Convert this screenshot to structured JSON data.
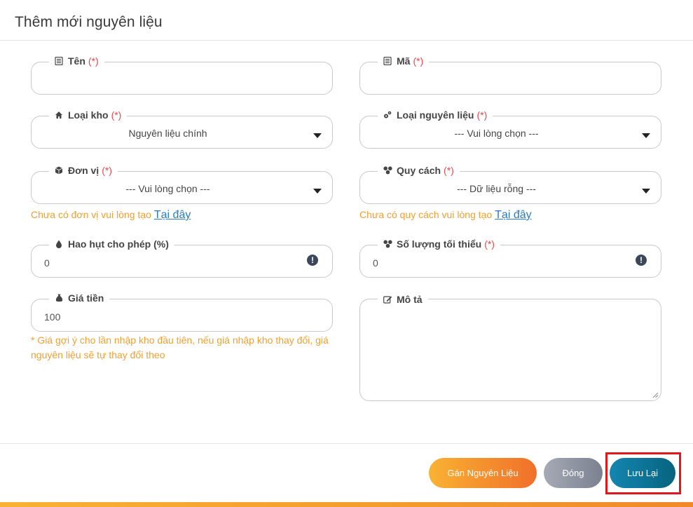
{
  "header": {
    "title": "Thêm mới nguyên liệu"
  },
  "required_mark": "(*)",
  "fields": {
    "ten": {
      "label": "Tên",
      "icon": "list-icon",
      "value": ""
    },
    "ma": {
      "label": "Mã",
      "icon": "list-icon",
      "value": ""
    },
    "loai_kho": {
      "label": "Loại kho",
      "icon": "home-icon",
      "value": "Nguyên liệu chính"
    },
    "loai_nguyen_lieu": {
      "label": "Loại nguyên liệu",
      "icon": "gears-icon",
      "value": "--- Vui lòng chọn ---"
    },
    "don_vi": {
      "label": "Đơn vị",
      "icon": "cube-icon",
      "value": "--- Vui lòng chọn ---"
    },
    "quy_cach": {
      "label": "Quy cách",
      "icon": "cubes-icon",
      "value": "--- Dữ liệu rỗng ---"
    },
    "hao_hut": {
      "label": "Hao hụt cho phép (%)",
      "icon": "drop-icon",
      "value": "0"
    },
    "so_luong_toi_thieu": {
      "label": "Số lượng tối thiểu",
      "icon": "cubes-icon",
      "value": "0"
    },
    "gia_tien": {
      "label": "Giá tiền",
      "icon": "money-bag-icon",
      "value": "100"
    },
    "mo_ta": {
      "label": "Mô tả",
      "icon": "edit-icon",
      "value": ""
    }
  },
  "hints": {
    "don_vi": {
      "text": "Chưa có đơn vị vui lòng tạo",
      "link": "Tại đây"
    },
    "quy_cach": {
      "text": "Chưa có quy cách vui lòng tạo",
      "link": "Tại đây"
    },
    "gia_tien_note": "* Giá gợi ý cho lần nhập kho đầu tiên, nếu giá nhập kho thay đổi, giá nguyên liệu sẽ tự thay đổi theo"
  },
  "buttons": {
    "assign": "Gán Nguyên Liệu",
    "close": "Đóng",
    "save": "Lưu Lại"
  },
  "colors": {
    "required": "#e5484d",
    "hint": "#f0a030",
    "link": "#2a7bbf",
    "save": "#07647f",
    "highlight": "#e0181b"
  }
}
